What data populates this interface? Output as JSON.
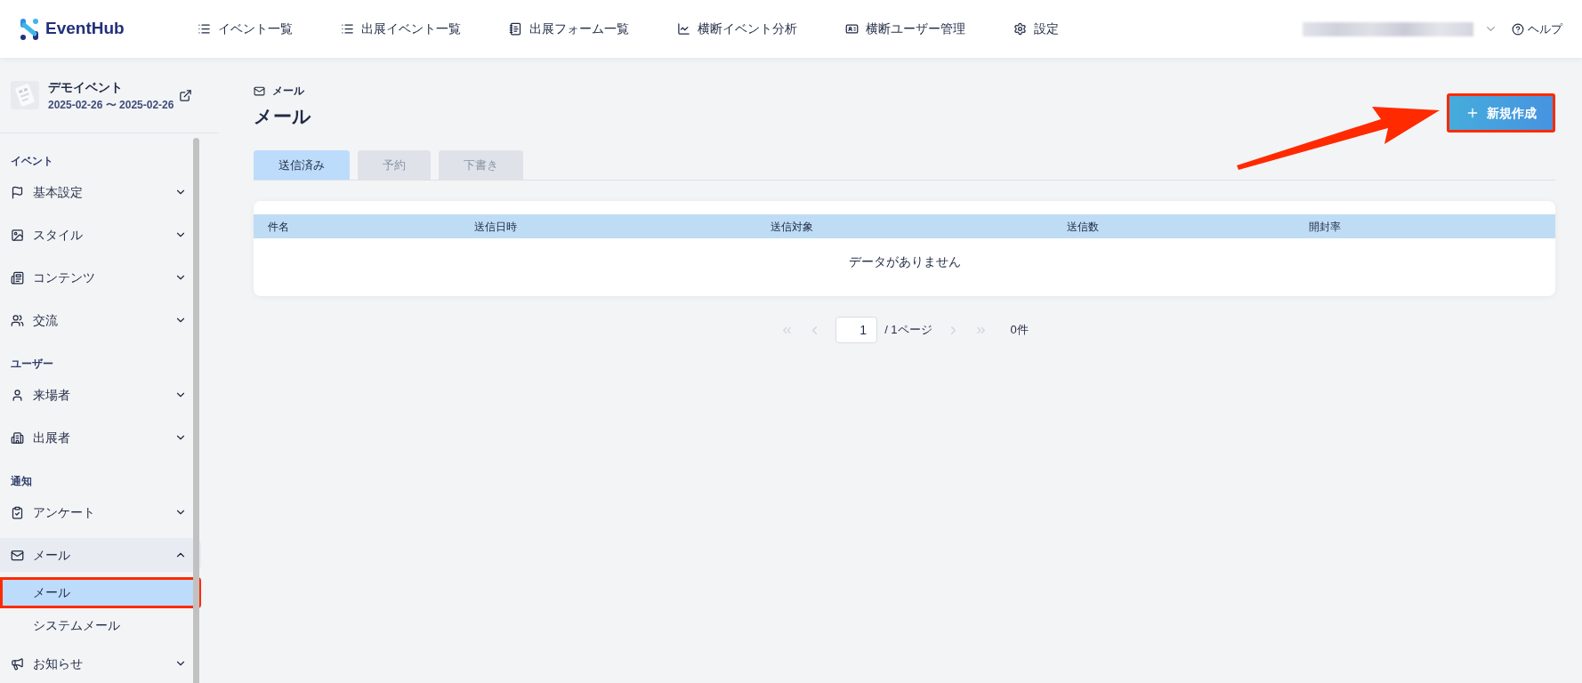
{
  "header": {
    "logo_text": "EventHub",
    "nav": [
      {
        "label": "イベント一覧"
      },
      {
        "label": "出展イベント一覧"
      },
      {
        "label": "出展フォーム一覧"
      },
      {
        "label": "横断イベント分析"
      },
      {
        "label": "横断ユーザー管理"
      },
      {
        "label": "設定"
      }
    ],
    "help": "ヘルプ"
  },
  "event": {
    "name": "デモイベント",
    "dates": "2025-02-26 〜 2025-02-26"
  },
  "sidebar": {
    "sections": [
      {
        "label": "イベント",
        "items": [
          {
            "label": "基本設定",
            "expanded": false
          },
          {
            "label": "スタイル",
            "expanded": false
          },
          {
            "label": "コンテンツ",
            "expanded": false
          },
          {
            "label": "交流",
            "expanded": false
          }
        ]
      },
      {
        "label": "ユーザー",
        "items": [
          {
            "label": "来場者",
            "expanded": false
          },
          {
            "label": "出展者",
            "expanded": false
          }
        ]
      },
      {
        "label": "通知",
        "items": [
          {
            "label": "アンケート",
            "expanded": false
          },
          {
            "label": "メール",
            "expanded": true,
            "children": [
              {
                "label": "メール",
                "selected": true,
                "highlighted": true
              },
              {
                "label": "システムメール",
                "selected": false,
                "highlighted": false
              }
            ]
          },
          {
            "label": "お知らせ",
            "expanded": false
          }
        ]
      }
    ]
  },
  "page": {
    "breadcrumb": "メール",
    "title": "メール",
    "new_button": {
      "label": "新規作成",
      "highlighted": true
    },
    "tabs": [
      {
        "label": "送信済み",
        "selected": true
      },
      {
        "label": "予約",
        "selected": false
      },
      {
        "label": "下書き",
        "selected": false
      }
    ],
    "table": {
      "columns": [
        "件名",
        "送信日時",
        "送信対象",
        "送信数",
        "開封率"
      ],
      "empty_message": "データがありません"
    },
    "pagination": {
      "page": "1",
      "total_pages": "/ 1ページ",
      "count": "0件"
    }
  }
}
